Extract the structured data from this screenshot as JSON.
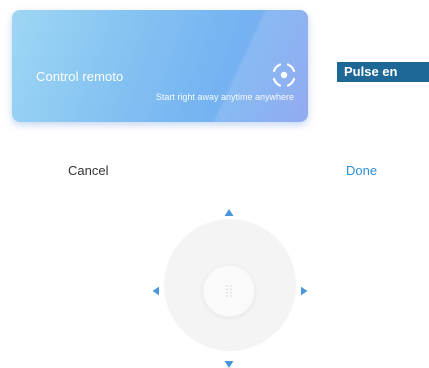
{
  "promo": {
    "title": "Control remoto",
    "subtitle": "Start right away anytime anywhere"
  },
  "banner": {
    "text": "Pulse en"
  },
  "actions": {
    "cancel_label": "Cancel",
    "done_label": "Done"
  },
  "colors": {
    "accent": "#2f8fd9",
    "arrow": "#4a96dd",
    "banner_bg": "#1d6896",
    "ring": "#f4f4f4"
  },
  "icons": {
    "scan": "scan-focus-icon",
    "up": "arrow-up-icon",
    "down": "arrow-down-icon",
    "left": "arrow-left-icon",
    "right": "arrow-right-icon",
    "center": "grip-dots-icon"
  }
}
